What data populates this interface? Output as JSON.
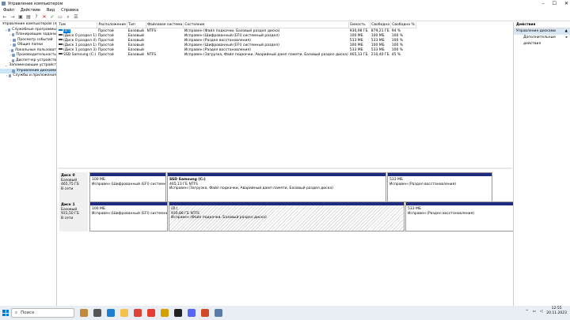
{
  "window": {
    "title": "Управление компьютером",
    "controls": [
      "–",
      "☐",
      "✕"
    ]
  },
  "menu": [
    "Файл",
    "Действие",
    "Вид",
    "Справка"
  ],
  "toolbar": [
    "back-icon",
    "forward-icon",
    "up-icon",
    "view-icon",
    "help-icon",
    "close-icon",
    "check-icon",
    "open-icon",
    "search-icon",
    "properties-icon"
  ],
  "tree": [
    {
      "label": "Управление компьютером (л",
      "level": 0,
      "exp": "",
      "icon": "computer-icon"
    },
    {
      "label": "Служебные программы",
      "level": 1,
      "exp": "⌄",
      "icon": "tools-icon"
    },
    {
      "label": "Планировщик задани",
      "level": 2,
      "exp": "›",
      "icon": "clock-icon"
    },
    {
      "label": "Просмотр событий",
      "level": 2,
      "exp": "›",
      "icon": "event-icon"
    },
    {
      "label": "Общие папки",
      "level": 2,
      "exp": "›",
      "icon": "folder-icon"
    },
    {
      "label": "Локальные пользоват",
      "level": 2,
      "exp": "›",
      "icon": "users-icon"
    },
    {
      "label": "Производительность",
      "level": 2,
      "exp": "›",
      "icon": "performance-icon"
    },
    {
      "label": "Диспетчер устройств",
      "level": 2,
      "exp": "",
      "icon": "device-icon"
    },
    {
      "label": "Запоминающие устройст",
      "level": 1,
      "exp": "⌄",
      "icon": "storage-icon"
    },
    {
      "label": "Управление дисками",
      "level": 2,
      "exp": "",
      "icon": "disk-icon",
      "selected": true
    },
    {
      "label": "Службы и приложения",
      "level": 1,
      "exp": "›",
      "icon": "services-icon"
    }
  ],
  "volumes": {
    "columns": [
      "Том",
      "Расположение",
      "Тип",
      "Файловая система",
      "Состояние",
      "Емкость",
      "Свободно",
      "Свободно %"
    ],
    "rows": [
      [
        "(D:)",
        "Простой",
        "Базовый",
        "NTFS",
        "Исправен (Файл подкачки, Базовый раздел диска)",
        "930,98 ГБ",
        "879,21 ГБ",
        "94 %"
      ],
      [
        "(Диск 0 раздел 1)",
        "Простой",
        "Базовый",
        "",
        "Исправен (Шифрованный (EFI) системный раздел)",
        "100 МБ",
        "100 МБ",
        "100 %"
      ],
      [
        "(Диск 0 раздел 4)",
        "Простой",
        "Базовый",
        "",
        "Исправен (Раздел восстановления)",
        "533 МБ",
        "533 МБ",
        "100 %"
      ],
      [
        "(Диск 1 раздел 1)",
        "Простой",
        "Базовый",
        "",
        "Исправен (Шифрованный (EFI) системный раздел)",
        "100 МБ",
        "100 МБ",
        "100 %"
      ],
      [
        "(Диск 1 раздел 3)",
        "Простой",
        "Базовый",
        "",
        "Исправен (Раздел восстановления)",
        "533 МБ",
        "533 МБ",
        "100 %"
      ],
      [
        "SSD Samsung (C:)",
        "Простой",
        "Базовый",
        "NTFS",
        "Исправен (Загрузка, Файл подкачки, Аварийный дамп памяти, Базовый раздел диска)",
        "465,13 ГБ",
        "210,40 ГБ",
        "45 %"
      ]
    ]
  },
  "disks": [
    {
      "name": "Диск 0",
      "type": "Базовый",
      "size": "465,75 ГБ",
      "status": "В сети",
      "parts": [
        {
          "title": "",
          "lines": [
            "100 МБ",
            "Исправен (Шифрованный (EFI) системный ра"
          ],
          "w": 97,
          "hatch": false
        },
        {
          "title": "SSD Samsung (C:)",
          "lines": [
            "465,13 ГБ NTFS",
            "Исправен (Загрузка, Файл подкачки, Аварийный дамп памяти, Базовый раздел диска)"
          ],
          "w": 277,
          "hatch": false
        },
        {
          "title": "",
          "lines": [
            "533 МБ",
            "Исправен (Раздел восстановления)"
          ],
          "w": 133,
          "hatch": false
        }
      ]
    },
    {
      "name": "Диск 1",
      "type": "Базовый",
      "size": "931,50 ГБ",
      "status": "В сети",
      "parts": [
        {
          "title": "",
          "lines": [
            "100 МБ",
            "Исправен (Шифрованный (EFI) системный ра"
          ],
          "w": 99,
          "hatch": false
        },
        {
          "title": "",
          "lines": [
            "(D:)",
            "930,88 ГБ NTFS",
            "Исправен (Файл подкачки, Базовый раздел диска)"
          ],
          "w": 298,
          "hatch": true
        },
        {
          "title": "",
          "lines": [
            "533 МБ",
            "Исправен (Раздел восстановления)"
          ],
          "w": 137,
          "hatch": false
        }
      ]
    }
  ],
  "actions": {
    "header": "Действия",
    "section": "Управление дисками",
    "item": "Дополнительные действия"
  },
  "taskbar": {
    "search": "Поиск",
    "time": "12:55",
    "date": "20.11.2023",
    "icons": [
      {
        "name": "weather-icon",
        "color": "#c08a3a"
      },
      {
        "name": "task-view-icon",
        "color": "#555555"
      },
      {
        "name": "edge-icon",
        "color": "#1e7fcf"
      },
      {
        "name": "explorer-icon",
        "color": "#f2c24a"
      },
      {
        "name": "chrome-icon",
        "color": "#db4437"
      },
      {
        "name": "yandex-icon",
        "color": "#e63b2e"
      },
      {
        "name": "mail-icon",
        "color": "#d4a000"
      },
      {
        "name": "app-icon",
        "color": "#222222"
      },
      {
        "name": "discord-icon",
        "color": "#5865f2"
      },
      {
        "name": "app2-icon",
        "color": "#d04a2a"
      },
      {
        "name": "computer-mgmt-icon",
        "color": "#5a7ca8"
      }
    ]
  }
}
